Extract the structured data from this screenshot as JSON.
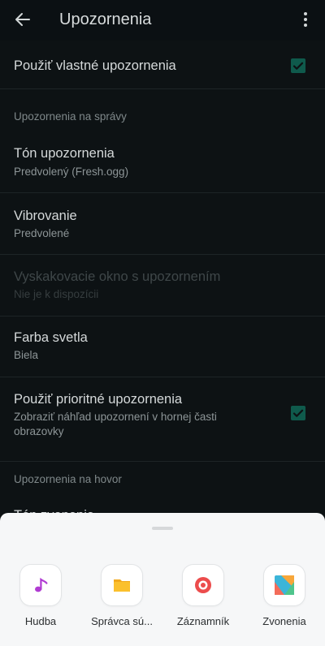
{
  "appbar": {
    "title": "Upozornenia",
    "back_icon": "arrow-left-icon",
    "menu_icon": "more-vertical-icon"
  },
  "settings": {
    "custom_notifications": {
      "title": "Použiť vlastné upozornenia",
      "checked": true
    },
    "section_messages": "Upozornenia na správy",
    "tone": {
      "title": "Tón upozornenia",
      "subtitle": "Predvolený (Fresh.ogg)"
    },
    "vibration": {
      "title": "Vibrovanie",
      "subtitle": "Predvolené"
    },
    "popup": {
      "title": "Vyskakovacie okno s upozornením",
      "subtitle": "Nie je k dispozícii",
      "enabled": false
    },
    "light_color": {
      "title": "Farba svetla",
      "subtitle": "Biela"
    },
    "priority": {
      "title": "Použiť prioritné upozornenia",
      "subtitle": "Zobraziť náhľad upozornení v hornej časti obrazovky",
      "checked": true
    },
    "section_calls": "Upozornenia na hovor",
    "call_tone": {
      "title": "Tón zvonenia"
    }
  },
  "sheet": {
    "apps": [
      {
        "label": "Hudba",
        "icon": "music-note-icon"
      },
      {
        "label": "Správca sú...",
        "icon": "folder-icon"
      },
      {
        "label": "Záznamník",
        "icon": "recorder-icon"
      },
      {
        "label": "Zvonenia",
        "icon": "ringtones-icon"
      }
    ]
  },
  "colors": {
    "background": "#0d1214",
    "accent_checkbox": "#0f5a4c",
    "sheet_background": "#f6f7f8"
  }
}
